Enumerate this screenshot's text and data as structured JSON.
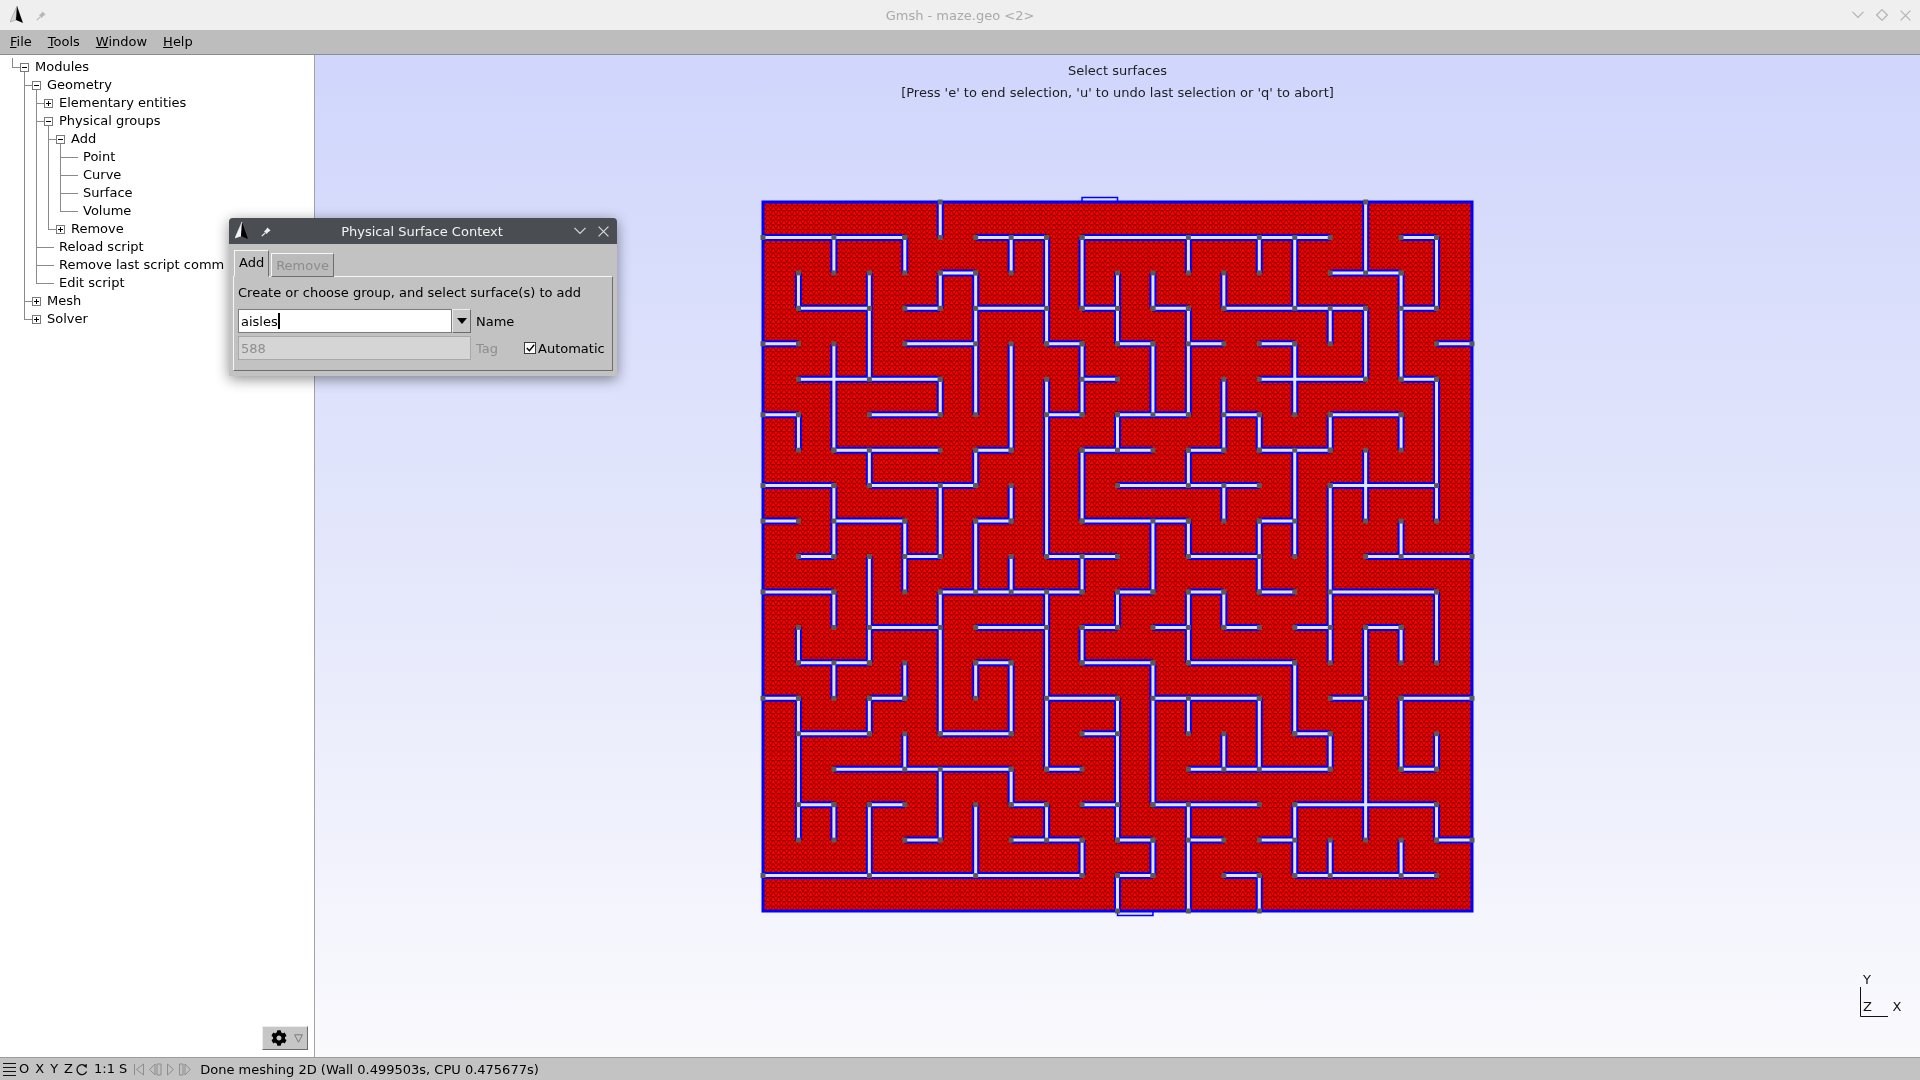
{
  "window": {
    "title": "Gmsh - maze.geo <2>"
  },
  "menu": [
    {
      "label": "File"
    },
    {
      "label": "Tools"
    },
    {
      "label": "Window"
    },
    {
      "label": "Help"
    }
  ],
  "tree": [
    {
      "label": "Modules",
      "expanded": true,
      "children": [
        {
          "label": "Geometry",
          "expanded": true,
          "children": [
            {
              "label": "Elementary entities",
              "expanded": false
            },
            {
              "label": "Physical groups",
              "expanded": true,
              "children": [
                {
                  "label": "Add",
                  "expanded": true,
                  "children": [
                    {
                      "label": "Point"
                    },
                    {
                      "label": "Curve"
                    },
                    {
                      "label": "Surface"
                    },
                    {
                      "label": "Volume"
                    }
                  ]
                },
                {
                  "label": "Remove",
                  "expanded": false
                }
              ]
            },
            {
              "label": "Reload script"
            },
            {
              "label": "Remove last script comm"
            },
            {
              "label": "Edit script"
            }
          ]
        },
        {
          "label": "Mesh",
          "expanded": false
        },
        {
          "label": "Solver",
          "expanded": false
        }
      ]
    }
  ],
  "viewport": {
    "prompt_title": "Select surfaces",
    "prompt_hint": "[Press 'e' to end selection, 'u' to undo last selection or 'q' to abort]",
    "axes": {
      "y": "Y",
      "z": "Z",
      "x": "X"
    }
  },
  "dialog": {
    "title": "Physical Surface Context",
    "tabs": [
      {
        "label": "Add",
        "selected": true,
        "disabled": false
      },
      {
        "label": "Remove",
        "selected": false,
        "disabled": true
      }
    ],
    "instruction": "Create or choose group, and select surface(s) to add",
    "name_field": {
      "value": "aisles",
      "label": "Name"
    },
    "tag_field": {
      "value": "588",
      "label": "Tag",
      "disabled": true
    },
    "automatic": {
      "label": "Automatic",
      "checked": true
    }
  },
  "status_bar": {
    "view_buttons": [
      "O",
      "X",
      "Y",
      "Z"
    ],
    "scale_button": "1:1",
    "s_button": "S",
    "animation_disabled": true,
    "message": "Done meshing 2D (Wall 0.499503s, CPU 0.475677s)"
  }
}
